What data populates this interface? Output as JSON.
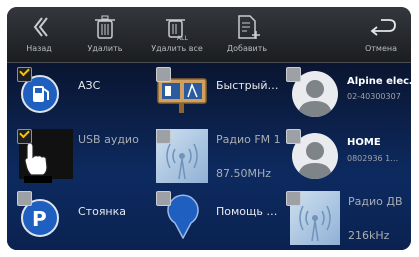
{
  "toolbar": {
    "back": "Назад",
    "delete": "Удалить",
    "delete_all": "Удалить все",
    "add": "Добавить",
    "cancel": "Отмена"
  },
  "tiles": {
    "gas": "АЗС",
    "quick": "Быстрый…",
    "alpine": "Alpine elec…",
    "alpine_number": "02-40300307",
    "usb": "USB аудио",
    "radio_fm": "Радио FM 1",
    "radio_fm_freq": "87.50MHz",
    "home": "HOME",
    "home_number": "0802936 1…",
    "parking": "Стоянка",
    "help": "Помощь …",
    "radio_lw": "Радио ДВ",
    "radio_lw_freq": "216kHz"
  },
  "checkboxes": {
    "gas": true,
    "quick": false,
    "alpine": false,
    "usb": true,
    "radio_fm": false,
    "home": false,
    "parking": false,
    "help": false,
    "radio_lw": false
  },
  "colors": {
    "accent_check": "#f1c40f",
    "toolbar_bg": "#2a2c30",
    "grid_bg": "#0d2a60",
    "icon_blue": "#1f5fc0"
  },
  "icons": {
    "back": "back-chevrons-icon",
    "delete": "trash-icon",
    "delete_all": "trash-all-icon",
    "add": "add-document-icon",
    "cancel": "return-arrow-icon"
  }
}
